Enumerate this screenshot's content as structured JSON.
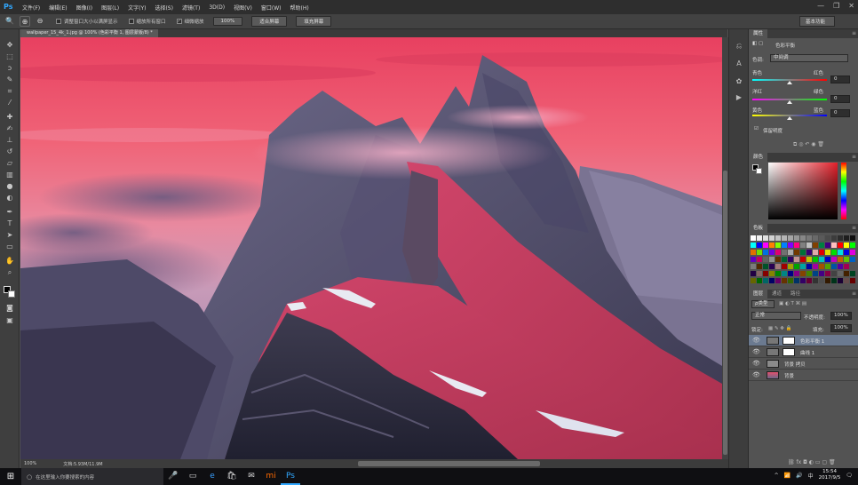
{
  "app": {
    "logo": "Ps"
  },
  "menu": [
    "文件(F)",
    "编辑(E)",
    "图像(I)",
    "图层(L)",
    "文字(Y)",
    "选择(S)",
    "滤镜(T)",
    "3D(D)",
    "视图(V)",
    "窗口(W)",
    "帮助(H)"
  ],
  "window_controls": {
    "minimize": "—",
    "maximize": "❐",
    "close": "✕"
  },
  "options_bar": {
    "check1": "调整窗口大小以满屏显示",
    "check2": "缩放所有窗口",
    "check3": "细微缩放",
    "btn_100": "100%",
    "btn_fit": "适合屏幕",
    "btn_fill": "填充屏幕",
    "workspace": "基本功能"
  },
  "document": {
    "tab_title": "wallpaper_15_4k_1.jpg @ 100% (色彩平衡 1, 图层蒙版/8) *",
    "zoom": "100%",
    "doc_size": "文档:5.93M/11.9M"
  },
  "adjustments_panel": {
    "tabs": [
      "属性"
    ],
    "title": "色彩平衡",
    "tone_label": "色调:",
    "tone_value": "中间调",
    "sliders": [
      {
        "left": "青色",
        "right": "红色",
        "value": "0"
      },
      {
        "left": "洋红",
        "right": "绿色",
        "value": "0"
      },
      {
        "left": "黄色",
        "right": "蓝色",
        "value": "0"
      }
    ],
    "preserve_label": "保留明度",
    "preserve_checked": true
  },
  "color_panel": {
    "tab": "颜色"
  },
  "swatches_panel": {
    "tab": "色板"
  },
  "layers_panel": {
    "tabs": [
      "图层",
      "通道",
      "路径"
    ],
    "kind_label": "ρ类型",
    "blend_mode": "正常",
    "opacity_label": "不透明度:",
    "opacity_value": "100%",
    "lock_label": "锁定:",
    "fill_label": "填充:",
    "fill_value": "100%",
    "layers": [
      {
        "name": "色彩平衡 1"
      },
      {
        "name": "曲线 1"
      },
      {
        "name": "背景 拷贝"
      },
      {
        "name": "背景"
      }
    ]
  },
  "taskbar": {
    "search_placeholder": "在这里输入你要搜索的内容",
    "time": "15:54",
    "date": "2017/9/5",
    "lang": "中"
  },
  "colors": {
    "menubar": "#2e2e2e",
    "panel_bg": "#535353",
    "accent_blue": "#31a8ff",
    "sky_top": "#e8486a",
    "ridge_red": "#c8405a"
  }
}
